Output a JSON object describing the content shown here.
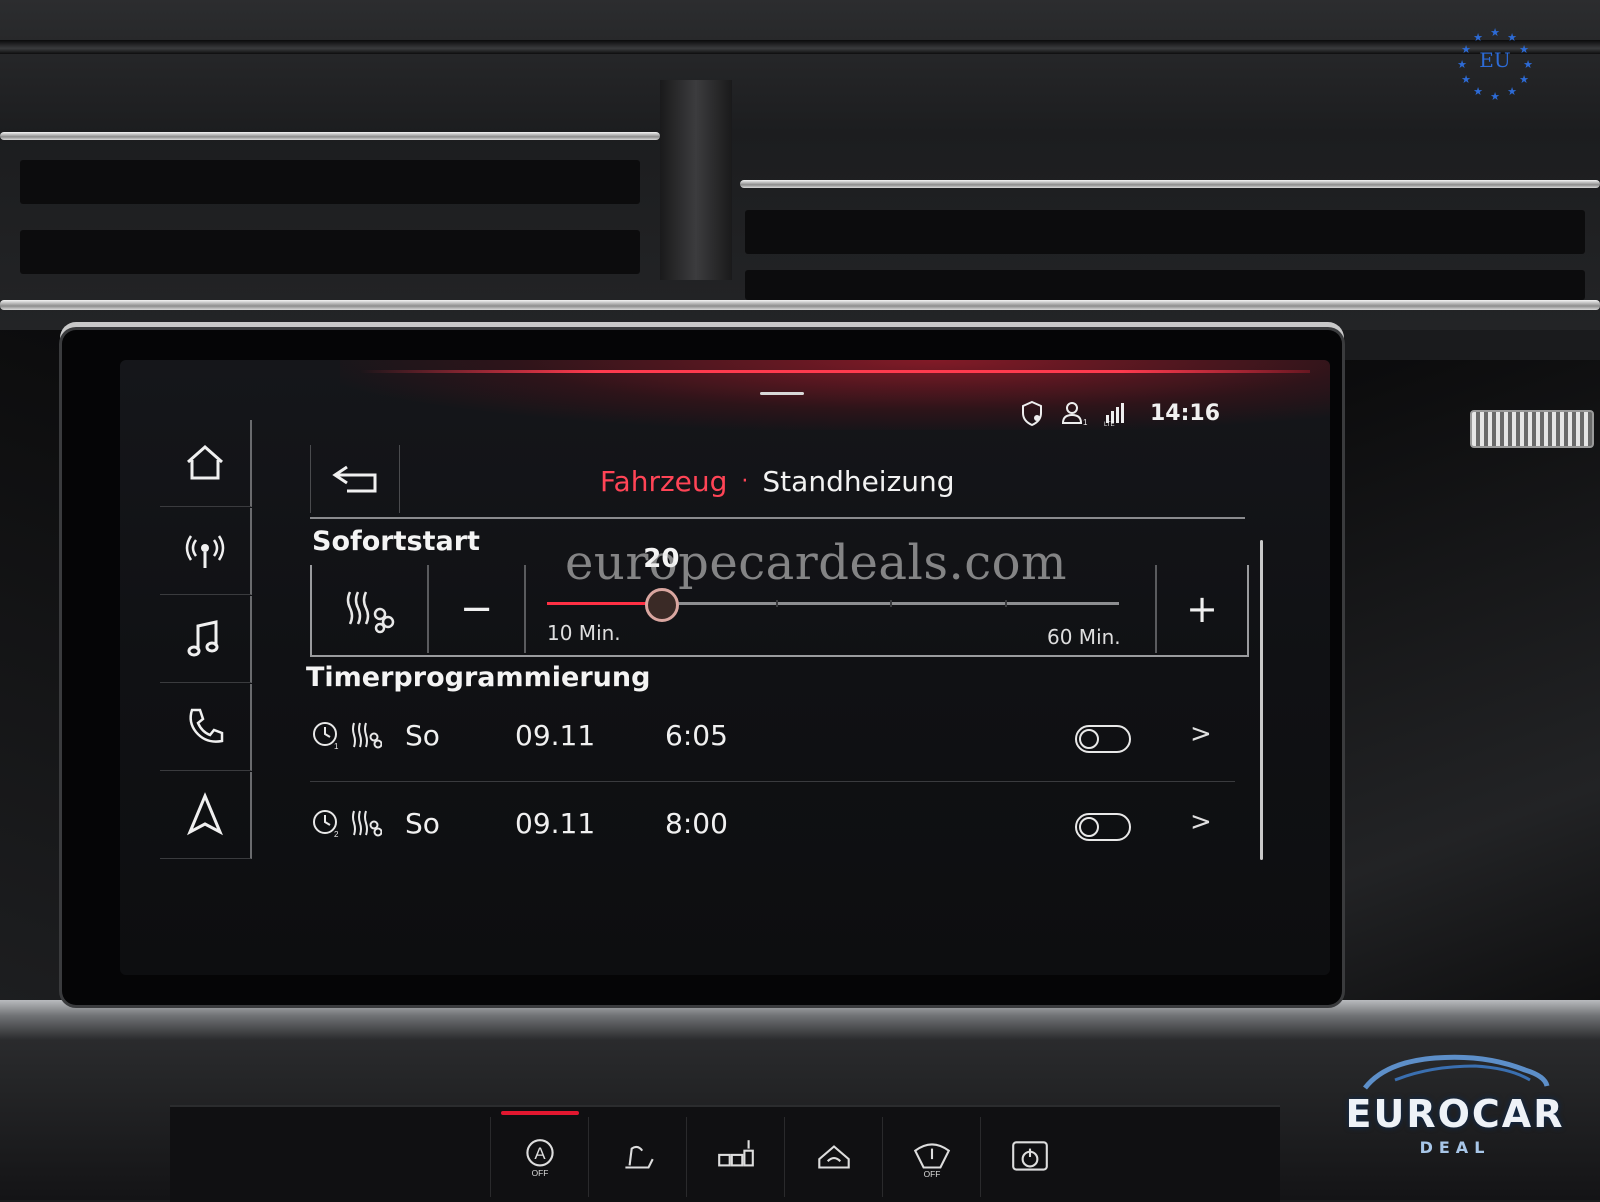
{
  "status_bar": {
    "icons": [
      "shield-location-icon",
      "user-profile-icon",
      "lte-signal-icon"
    ],
    "time": "14:16"
  },
  "nav": {
    "items": [
      {
        "icon": "home-icon"
      },
      {
        "icon": "radio-icon"
      },
      {
        "icon": "music-icon"
      },
      {
        "icon": "phone-icon"
      },
      {
        "icon": "navigation-icon"
      }
    ]
  },
  "header": {
    "parent": "Fahrzeug",
    "separator": "·",
    "current": "Standheizung"
  },
  "quick_start": {
    "title": "Sofortstart",
    "value": "20",
    "min_label": "10 Min.",
    "max_label": "60 Min.",
    "min": 10,
    "max": 60,
    "current": 20,
    "minus_label": "−",
    "plus_label": "+"
  },
  "timers": {
    "title": "Timerprogrammierung",
    "items": [
      {
        "day": "So",
        "date": "09.11",
        "time": "6:05",
        "enabled": false,
        "arrow": ">"
      },
      {
        "day": "So",
        "date": "09.11",
        "time": "8:00",
        "enabled": false,
        "arrow": ">"
      }
    ]
  },
  "overlay": {
    "watermark": "europecardeals.com",
    "eu_badge": "EU",
    "brand_name": "EUROCAR",
    "brand_sub": "DEAL"
  },
  "colors": {
    "accent": "#ff3044",
    "brand_blue": "#2d6bd6"
  },
  "climate_controls": {
    "icons": [
      "auto-off-icon",
      "seat-heat-icon",
      "defrost-rear-icon",
      "recirculation-icon",
      "wiper-off-icon",
      "power-icon"
    ]
  }
}
